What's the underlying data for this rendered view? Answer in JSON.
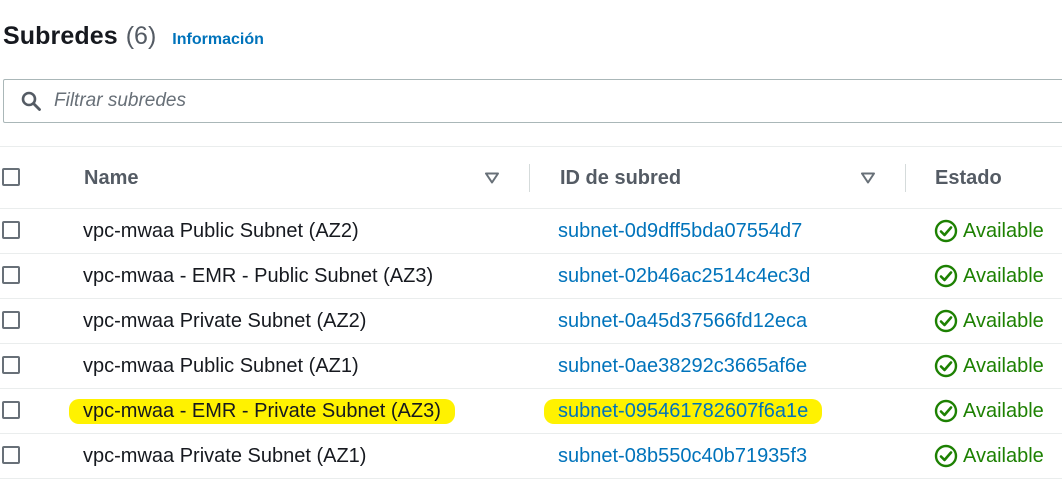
{
  "header": {
    "title": "Subredes",
    "count": "(6)",
    "info_link": "Información"
  },
  "search": {
    "placeholder": "Filtrar subredes",
    "value": ""
  },
  "table": {
    "columns": {
      "name": "Name",
      "subnet_id": "ID de subred",
      "state": "Estado"
    },
    "rows": [
      {
        "name": "vpc-mwaa Public Subnet (AZ2)",
        "subnet_id": "subnet-0d9dff5bda07554d7",
        "state": "Available",
        "highlighted": false
      },
      {
        "name": "vpc-mwaa - EMR - Public Subnet (AZ3)",
        "subnet_id": "subnet-02b46ac2514c4ec3d",
        "state": "Available",
        "highlighted": false
      },
      {
        "name": "vpc-mwaa Private Subnet (AZ2)",
        "subnet_id": "subnet-0a45d37566fd12eca",
        "state": "Available",
        "highlighted": false
      },
      {
        "name": "vpc-mwaa Public Subnet (AZ1)",
        "subnet_id": "subnet-0ae38292c3665af6e",
        "state": "Available",
        "highlighted": false
      },
      {
        "name": "vpc-mwaa - EMR - Private Subnet (AZ3)",
        "subnet_id": "subnet-095461782607f6a1e",
        "state": "Available",
        "highlighted": true
      },
      {
        "name": "vpc-mwaa Private Subnet (AZ1)",
        "subnet_id": "subnet-08b550c40b71935f3",
        "state": "Available",
        "highlighted": false
      }
    ]
  },
  "colors": {
    "link": "#0073bb",
    "success": "#1d8102",
    "highlight": "#fff200"
  },
  "icons": {
    "search": "search-icon",
    "sort": "caret-down-icon",
    "status": "status-positive-icon"
  }
}
